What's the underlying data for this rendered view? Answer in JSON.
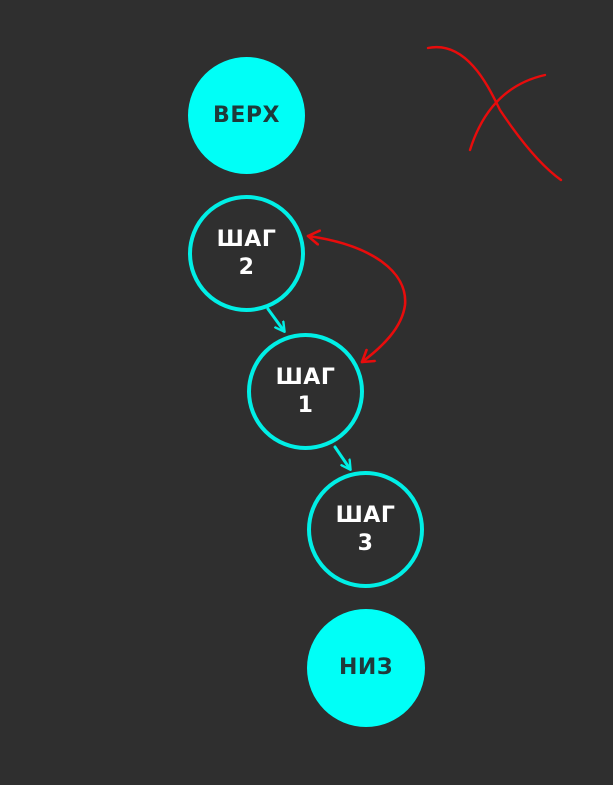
{
  "colors": {
    "background": "#2f2f2f",
    "cyan": "#00fff7",
    "ring": "#00efe6",
    "red": "#e80c0c",
    "text_light": "#ffffff",
    "text_dark": "#1f3a3b"
  },
  "nodes": {
    "top": {
      "label": "ВЕРХ"
    },
    "step2": {
      "line1": "ШАГ",
      "line2": "2"
    },
    "step1": {
      "line1": "ШАГ",
      "line2": "1"
    },
    "step3": {
      "line1": "ШАГ",
      "line2": "3"
    },
    "bottom": {
      "label": "НИЗ"
    }
  }
}
